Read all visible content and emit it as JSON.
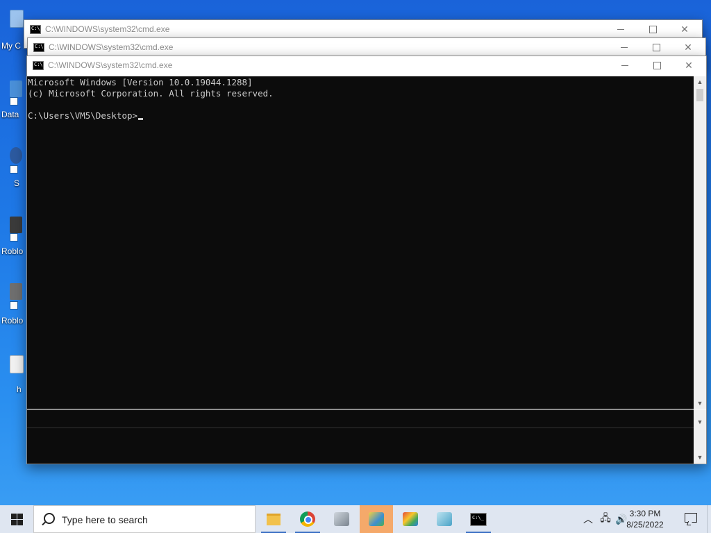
{
  "desktop": {
    "icons": [
      {
        "label": "My C",
        "name": "desktop-icon-my-computer",
        "color": "#9cc3ee"
      },
      {
        "label": "Data",
        "name": "desktop-icon-data",
        "color": "#4a90d9"
      },
      {
        "label": "S",
        "name": "desktop-icon-s",
        "color": "#2c5aa0"
      },
      {
        "label": "Roblo",
        "name": "desktop-icon-roblox-1",
        "color": "#3b3b3b"
      },
      {
        "label": "Roblo",
        "name": "desktop-icon-roblox-2",
        "color": "#6f6f6f"
      },
      {
        "label": "h",
        "name": "desktop-icon-h",
        "color": "#f2f2f2"
      }
    ]
  },
  "windows": [
    {
      "title": "C:\\WINDOWS\\system32\\cmd.exe"
    },
    {
      "title": "C:\\WINDOWS\\system32\\cmd.exe"
    },
    {
      "title": "C:\\WINDOWS\\system32\\cmd.exe"
    }
  ],
  "console": {
    "line1": "Microsoft Windows [Version 10.0.19044.1288]",
    "line2": "(c) Microsoft Corporation. All rights reserved.",
    "prompt": "C:\\Users\\VM5\\Desktop>"
  },
  "taskbar": {
    "search_placeholder": "Type here to search",
    "apps": [
      {
        "name": "taskbar-file-explorer",
        "icon": "folder-icon",
        "active": false
      },
      {
        "name": "taskbar-chrome",
        "icon": "chrome-icon",
        "active": false
      },
      {
        "name": "taskbar-app-3",
        "icon": "app-icon",
        "active": false
      },
      {
        "name": "taskbar-app-4",
        "icon": "app-icon",
        "active": true
      },
      {
        "name": "taskbar-app-5",
        "icon": "app-icon",
        "active": false
      },
      {
        "name": "taskbar-app-6",
        "icon": "app-icon",
        "active": false
      },
      {
        "name": "taskbar-cmd",
        "icon": "cmd-icon",
        "active": false
      }
    ],
    "clock_time": "3:30 PM",
    "clock_date": "8/25/2022"
  }
}
